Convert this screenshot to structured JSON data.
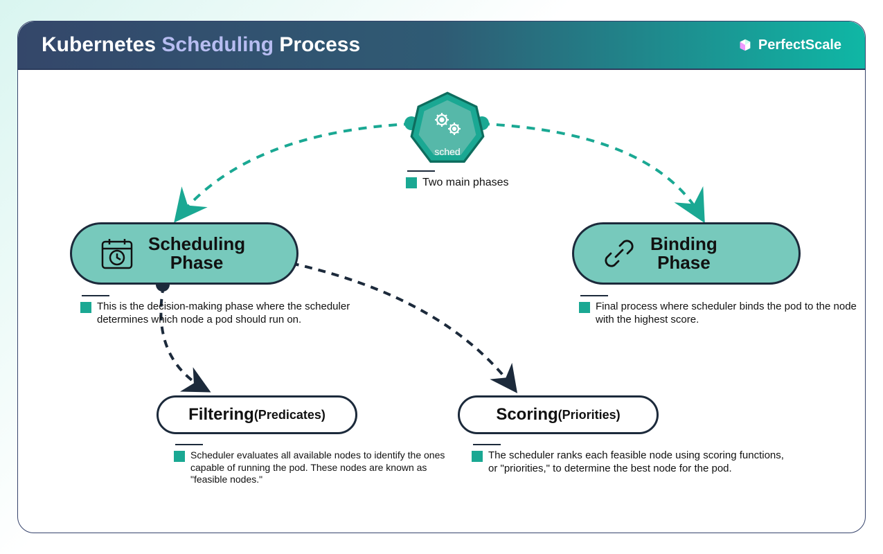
{
  "brand": {
    "name": "PerfectScale"
  },
  "title": {
    "prefix": "Kubernetes ",
    "accent": "Scheduling",
    "suffix": " Process"
  },
  "sched": {
    "label": "sched",
    "note": "Two main phases"
  },
  "scheduling": {
    "label_line1": "Scheduling",
    "label_line2": "Phase",
    "desc": "This is the decision-making phase where the scheduler determines which node a pod should run on."
  },
  "binding": {
    "label_line1": "Binding",
    "label_line2": "Phase",
    "desc": "Final process where scheduler binds the pod to the node with the highest score."
  },
  "filtering": {
    "main": "Filtering",
    "sub": "(Predicates)",
    "desc": "Scheduler evaluates all available nodes to identify the ones capable of running the pod. These nodes are known as \"feasible nodes.\""
  },
  "scoring": {
    "main": "Scoring",
    "sub": "(Priorities)",
    "desc": "The scheduler ranks each feasible node using scoring functions, or \"priorities,\" to determine the best node for the pod."
  },
  "colors": {
    "teal": "#1aa893",
    "dark": "#1c2a3b"
  }
}
